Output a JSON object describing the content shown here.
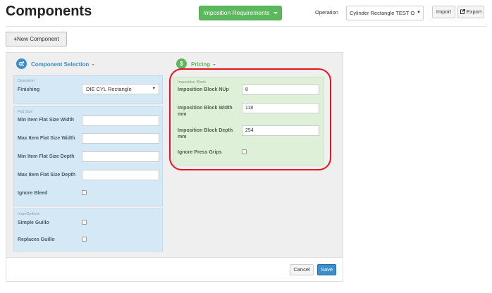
{
  "header": {
    "title": "Components",
    "imposition_button": "Imposition Requirements",
    "operation_label": "Operation",
    "operation_value": "Cylinder Rectangle TEST OI",
    "import_label": "Import",
    "export_label": "Export",
    "export_icon": "export-icon"
  },
  "toolbar": {
    "new_component_label": "New Component",
    "new_component_icon": "plus-icon"
  },
  "component_selection": {
    "heading": "Component Selection",
    "icon": "cogs-icon",
    "operation_group": {
      "title": "Operation",
      "finishing_label": "Finishing",
      "finishing_value": "DIE CYL Rectangle"
    },
    "flat_size_group": {
      "title": "Flat Size",
      "fields": [
        {
          "label": "Min Item Flat Size Width",
          "value": ""
        },
        {
          "label": "Max Item Flat Size Width",
          "value": ""
        },
        {
          "label": "Min Item Flat Size Depth",
          "value": ""
        },
        {
          "label": "Max Item Flat Size Depth",
          "value": ""
        }
      ],
      "ignore_bleed_label": "Ignore Bleed"
    },
    "impo_options_group": {
      "title": "ImpoOptions",
      "simple_guillo_label": "Simple Guillo",
      "replaces_guillo_label": "Replaces Guillo"
    }
  },
  "pricing": {
    "heading": "Pricing",
    "icon": "dollar-icon",
    "imposition_block": {
      "title": "Imposition Block",
      "nup_label": "Imposition Block NUp",
      "nup_value": "8",
      "width_label_1": "Imposition Block Width",
      "width_label_2": "mm",
      "width_value": "118",
      "depth_label_1": "Imposition Block Depth",
      "depth_label_2": "mm",
      "depth_value": "254",
      "ignore_press_grips_label": "Ignore Press Grips"
    }
  },
  "footer": {
    "cancel_label": "Cancel",
    "save_label": "Save"
  },
  "colors": {
    "accent_green": "#5cb85c",
    "highlight_red": "#e8141b",
    "save_blue": "#3a8ec9",
    "component_icon_blue": "#3a8ec9",
    "pricing_icon_green": "#5cb85c"
  }
}
